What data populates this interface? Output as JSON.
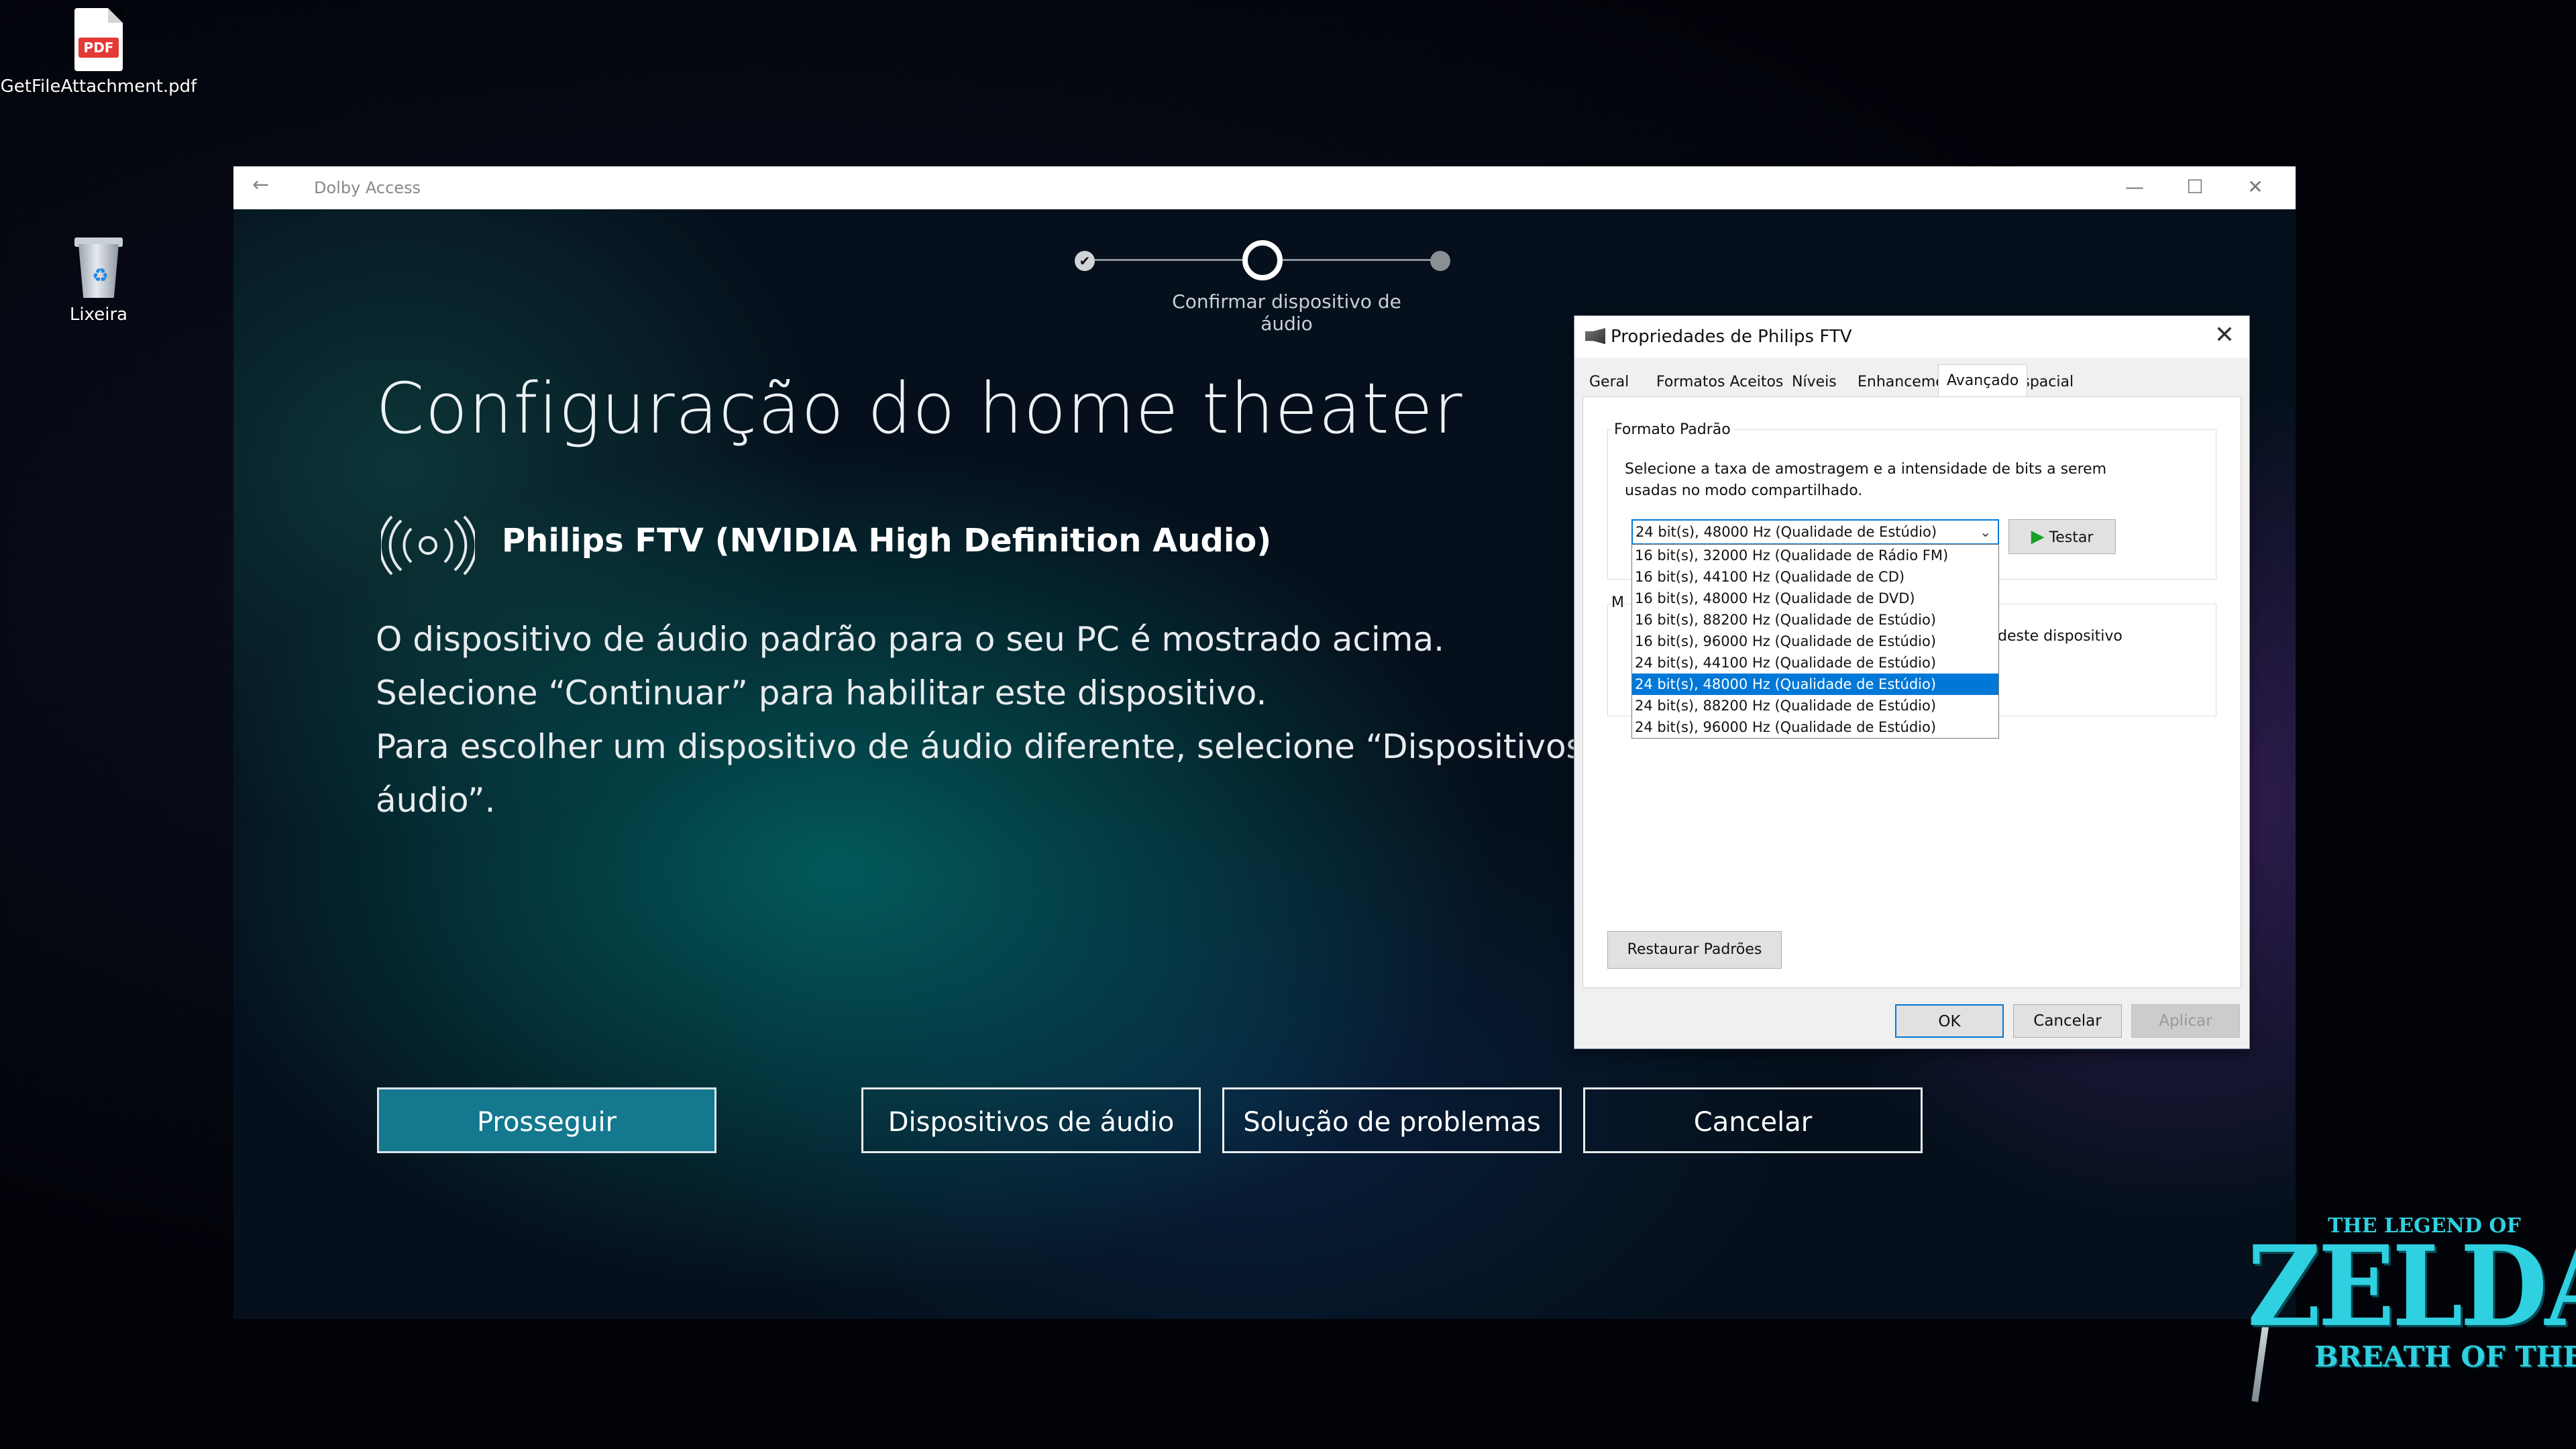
{
  "desktop": {
    "icons": [
      {
        "label": "GetFileAttachment.pdf",
        "icon": "pdf-file-icon",
        "tag": "PDF"
      },
      {
        "label": "Lixeira",
        "icon": "recycle-bin-icon"
      }
    ]
  },
  "window": {
    "title": "Dolby Access",
    "back_icon": "←",
    "controls": {
      "minimize": "—",
      "maximize": "☐",
      "close": "✕"
    }
  },
  "stepper": {
    "current_label": "Confirmar dispositivo de áudio",
    "steps_total": 3,
    "current_step": 2,
    "done_icon": "✔"
  },
  "main": {
    "heading": "Configuração do home theater",
    "device_name": "Philips FTV (NVIDIA High Definition Audio)",
    "device_icon": "broadcast-icon",
    "description": [
      "O dispositivo de áudio padrão para o seu PC é mostrado acima.",
      "Selecione “Continuar” para habilitar este dispositivo.",
      "Para escolher um dispositivo de áudio diferente, selecione “Dispositivos de",
      "áudio”."
    ],
    "buttons": {
      "continue": "Prosseguir",
      "devices": "Dispositivos de áudio",
      "troubleshoot": "Solução de problemas",
      "cancel": "Cancelar"
    }
  },
  "dialog": {
    "title": "Propriedades de Philips FTV",
    "close": "✕",
    "tabs": [
      "Geral",
      "Formatos Aceitos",
      "Níveis",
      "Enhancements",
      "Avançado",
      "Som espacial"
    ],
    "active_tab": "Avançado",
    "group_title": "Formato Padrão",
    "group_desc": "Selecione a taxa de amostragem e a intensidade de bits a serem usadas no modo compartilhado.",
    "combo_value": "24 bit(s), 48000 Hz (Qualidade de Estúdio)",
    "test_label": "Testar",
    "options": [
      "16 bit(s), 32000 Hz (Qualidade de Rádio FM)",
      "16 bit(s), 44100 Hz (Qualidade de CD)",
      "16 bit(s), 48000 Hz (Qualidade de DVD)",
      "16 bit(s), 88200 Hz (Qualidade de Estúdio)",
      "16 bit(s), 96000 Hz (Qualidade de Estúdio)",
      "24 bit(s), 44100 Hz (Qualidade de Estúdio)",
      "24 bit(s), 48000 Hz (Qualidade de Estúdio)",
      "24 bit(s), 88200 Hz (Qualidade de Estúdio)",
      "24 bit(s), 96000 Hz (Qualidade de Estúdio)"
    ],
    "selected_option": "24 bit(s), 48000 Hz (Qualidade de Estúdio)",
    "group2_label": "M",
    "group2_text": "deste dispositivo",
    "restore_label": "Restaurar Padrões",
    "ok_label": "OK",
    "cancel_label": "Cancelar",
    "apply_label": "Aplicar"
  },
  "wallpaper": {
    "logo_top": "THE LEGEND OF",
    "logo_main": "ZELDA",
    "logo_sub": "BREATH OF THE WILD"
  },
  "colors": {
    "accent_button": "#14788f",
    "selection": "#0078d7",
    "logo": "#2fd0e0"
  }
}
